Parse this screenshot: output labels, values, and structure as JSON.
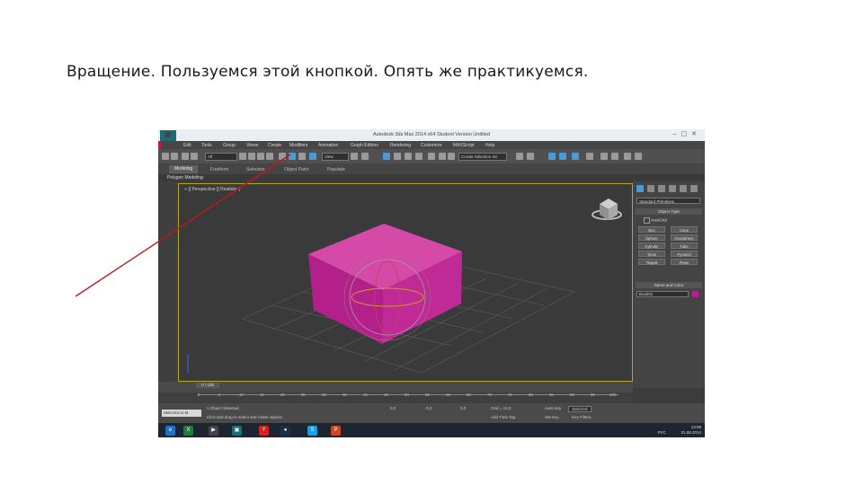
{
  "slide": {
    "caption": "Вращение. Пользуемся этой кнопкой. Опять же практикуемся."
  },
  "window": {
    "title": "Autodesk 3ds Max 2014 x64   Student Version   Untitled",
    "menu": [
      "Edit",
      "Tools",
      "Group",
      "Views",
      "Create",
      "Modifiers",
      "Animation",
      "Graph Editors",
      "Rendering",
      "Customize",
      "MAXScript",
      "Help"
    ],
    "selection_filter": "All",
    "view_dropdown": "View",
    "named_selection": "Create Selection Se"
  },
  "ribbon": {
    "tabs": [
      "Modeling",
      "Freeform",
      "Selection",
      "Object Paint",
      "Populate"
    ],
    "active": "Modeling",
    "sub": "Polygon Modeling"
  },
  "viewport": {
    "label": "+ ][ Perspective ][ Realistic ]"
  },
  "command_panel": {
    "category": "Standard Primitives",
    "object_type_header": "Object Type",
    "autogrid": "AutoGrid",
    "buttons": [
      "Box",
      "Cone",
      "Sphere",
      "GeoSphere",
      "Cylinder",
      "Tube",
      "Torus",
      "Pyramid",
      "Teapot",
      "Plane"
    ],
    "name_color_header": "Name and Color",
    "object_name": "Box001",
    "object_color": "#b3208a"
  },
  "timeline": {
    "slider": "0 / 100",
    "ticks": [
      "0",
      "5",
      "10",
      "15",
      "20",
      "25",
      "30",
      "35",
      "40",
      "45",
      "50",
      "55",
      "60",
      "65",
      "70",
      "75",
      "80",
      "85",
      "90",
      "95",
      "100"
    ]
  },
  "status": {
    "welcome": "Welcome to M",
    "selected": "1 Object Selected",
    "prompt": "Click and drag to select and rotate objects",
    "x": "0,0",
    "y": "0,0",
    "z": "0,0",
    "grid": "Grid = 10,0",
    "add_time_tag": "Add Time Tag",
    "auto_key": "Auto Key",
    "selected_dropdown": "Selected",
    "set_key": "Set Key",
    "key_filters": "Key Filters..."
  },
  "taskbar": {
    "apps": [
      "IE",
      "Excel",
      "Explorer",
      "Camtasia",
      "3ds Max",
      "Yandex",
      "Steam",
      "Skype",
      "PowerPoint"
    ],
    "time": "13:08",
    "date": "31.08.2014",
    "lang": "РУС"
  },
  "colors": {
    "accent_red": "#c9202a",
    "viewport_border": "#b5a629",
    "box_color": "#b3208a"
  }
}
